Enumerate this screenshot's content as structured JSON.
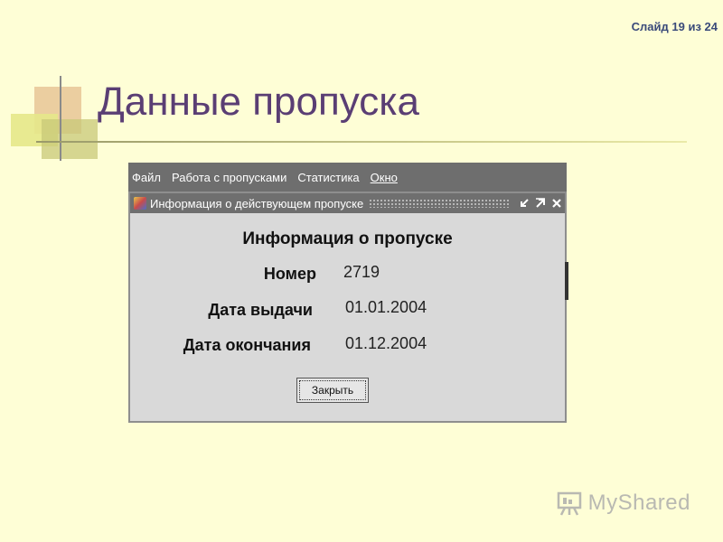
{
  "slide_counter": "Слайд 19 из 24",
  "title": "Данные пропуска",
  "menubar": {
    "items": [
      {
        "label": "Файл"
      },
      {
        "label": "Работа с пропусками"
      },
      {
        "label": "Статистика"
      },
      {
        "label": "Окно"
      }
    ]
  },
  "dialog": {
    "title": "Информация о действующем пропуске",
    "heading": "Информация о пропуске",
    "fields": [
      {
        "label": "Номер",
        "value": "2719"
      },
      {
        "label": "Дата выдачи",
        "value": "01.01.2004"
      },
      {
        "label": "Дата окончания",
        "value": "01.12.2004"
      }
    ],
    "close_label": "Закрыть"
  },
  "watermark": {
    "text": "MyShared"
  },
  "colors": {
    "background": "#fefed6",
    "title": "#5a3e74",
    "menubar": "#6e6e6e",
    "dialog": "#d9d9d9"
  }
}
